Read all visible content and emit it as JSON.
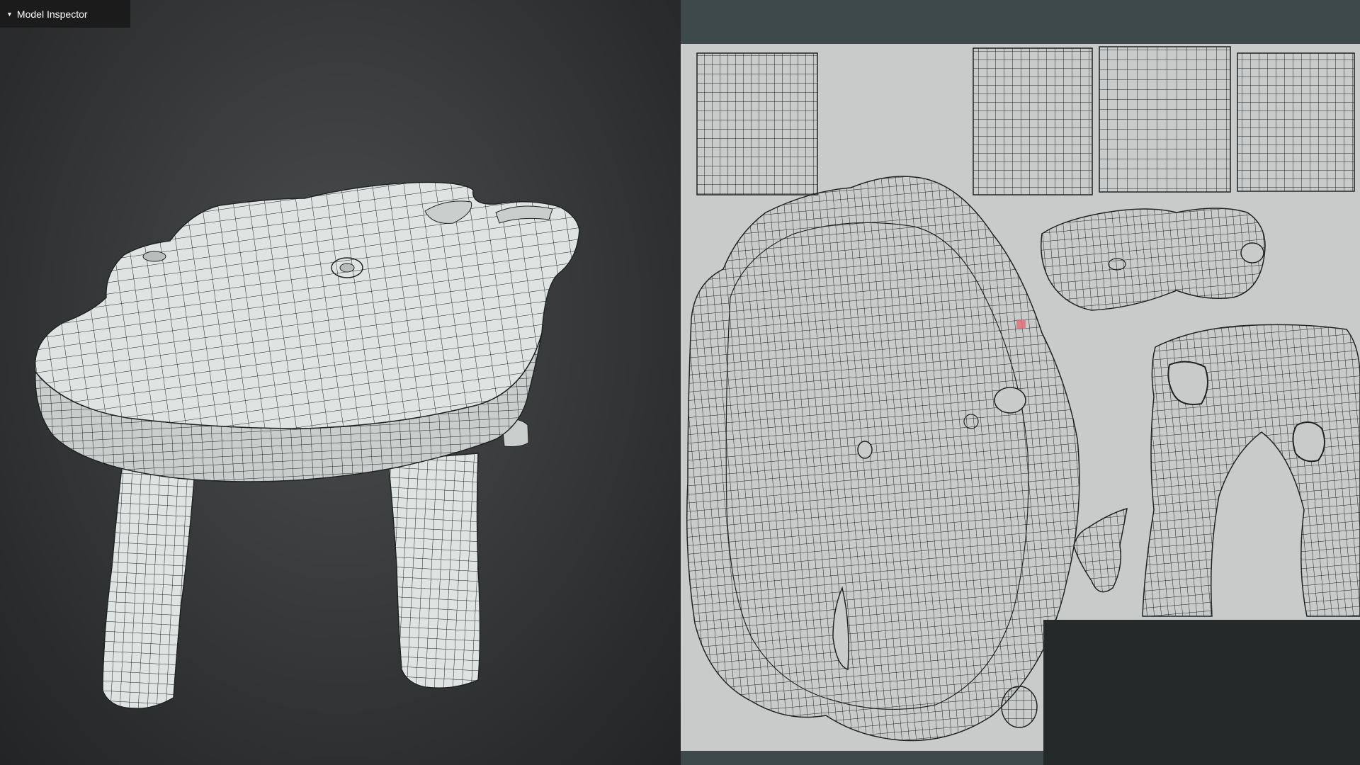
{
  "inspector": {
    "label": "Model Inspector",
    "caret_icon": "triangle-down-icon"
  },
  "colors": {
    "viewport_bg": "#3c3d3e",
    "mesh_fill": "#dfe3e2",
    "mesh_shade": "#c9cdcc",
    "wire": "#1f2324",
    "uv_canvas": "#c9cbca",
    "uv_header": "#3d4849",
    "uv_overlay": "#25292a",
    "uv_highlight": "#e56b73"
  }
}
